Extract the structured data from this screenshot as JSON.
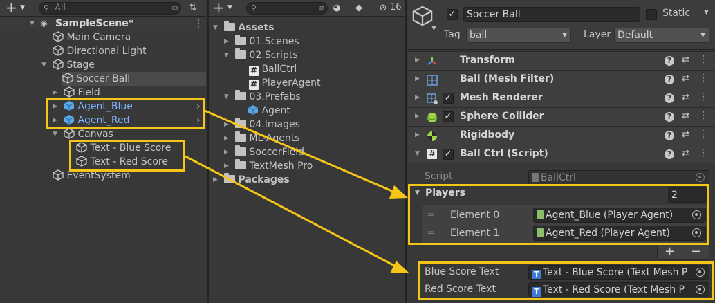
{
  "hierarchy": {
    "search_placeholder": "All",
    "scene_name": "SampleScene*",
    "items": [
      {
        "label": "Main Camera"
      },
      {
        "label": "Directional Light"
      },
      {
        "label": "Stage"
      },
      {
        "label": "Soccer Ball"
      },
      {
        "label": "Field"
      },
      {
        "label": "Agent_Blue"
      },
      {
        "label": "Agent_Red"
      },
      {
        "label": "Canvas"
      },
      {
        "label": "Text - Blue Score"
      },
      {
        "label": "Text - Red Score"
      },
      {
        "label": "EventSystem"
      }
    ]
  },
  "project": {
    "visibility_count": "16",
    "items": [
      {
        "label": "Assets"
      },
      {
        "label": "01.Scenes"
      },
      {
        "label": "02.Scripts"
      },
      {
        "label": "BallCtrl"
      },
      {
        "label": "PlayerAgent"
      },
      {
        "label": "03.Prefabs"
      },
      {
        "label": "Agent"
      },
      {
        "label": "04.Images"
      },
      {
        "label": "ML-Agents"
      },
      {
        "label": "SoccerField"
      },
      {
        "label": "TextMesh Pro"
      },
      {
        "label": "Packages"
      }
    ]
  },
  "inspector": {
    "object_name": "Soccer Ball",
    "static_label": "Static",
    "tag_label": "Tag",
    "tag_value": "ball",
    "layer_label": "Layer",
    "layer_value": "Default",
    "components": [
      {
        "name": "Transform"
      },
      {
        "name": "Ball (Mesh Filter)"
      },
      {
        "name": "Mesh Renderer"
      },
      {
        "name": "Sphere Collider"
      },
      {
        "name": "Rigidbody"
      },
      {
        "name": "Ball Ctrl (Script)"
      }
    ],
    "script_label": "Script",
    "script_value": "BallCtrl",
    "players_label": "Players",
    "players_count": "2",
    "elements": [
      {
        "label": "Element 0",
        "value": "Agent_Blue (Player Agent)"
      },
      {
        "label": "Element 1",
        "value": "Agent_Red (Player Agent)"
      }
    ],
    "add_symbol": "+",
    "remove_symbol": "−",
    "blue_score_label": "Blue Score Text",
    "blue_score_value": "Text - Blue Score (Text Mesh P",
    "red_score_label": "Red Score Text",
    "red_score_value": "Text - Red Score (Text Mesh P"
  },
  "colors": {
    "highlight": "#f5c518",
    "selection_blue": "#7fb3ff",
    "panel_bg": "#383838"
  }
}
